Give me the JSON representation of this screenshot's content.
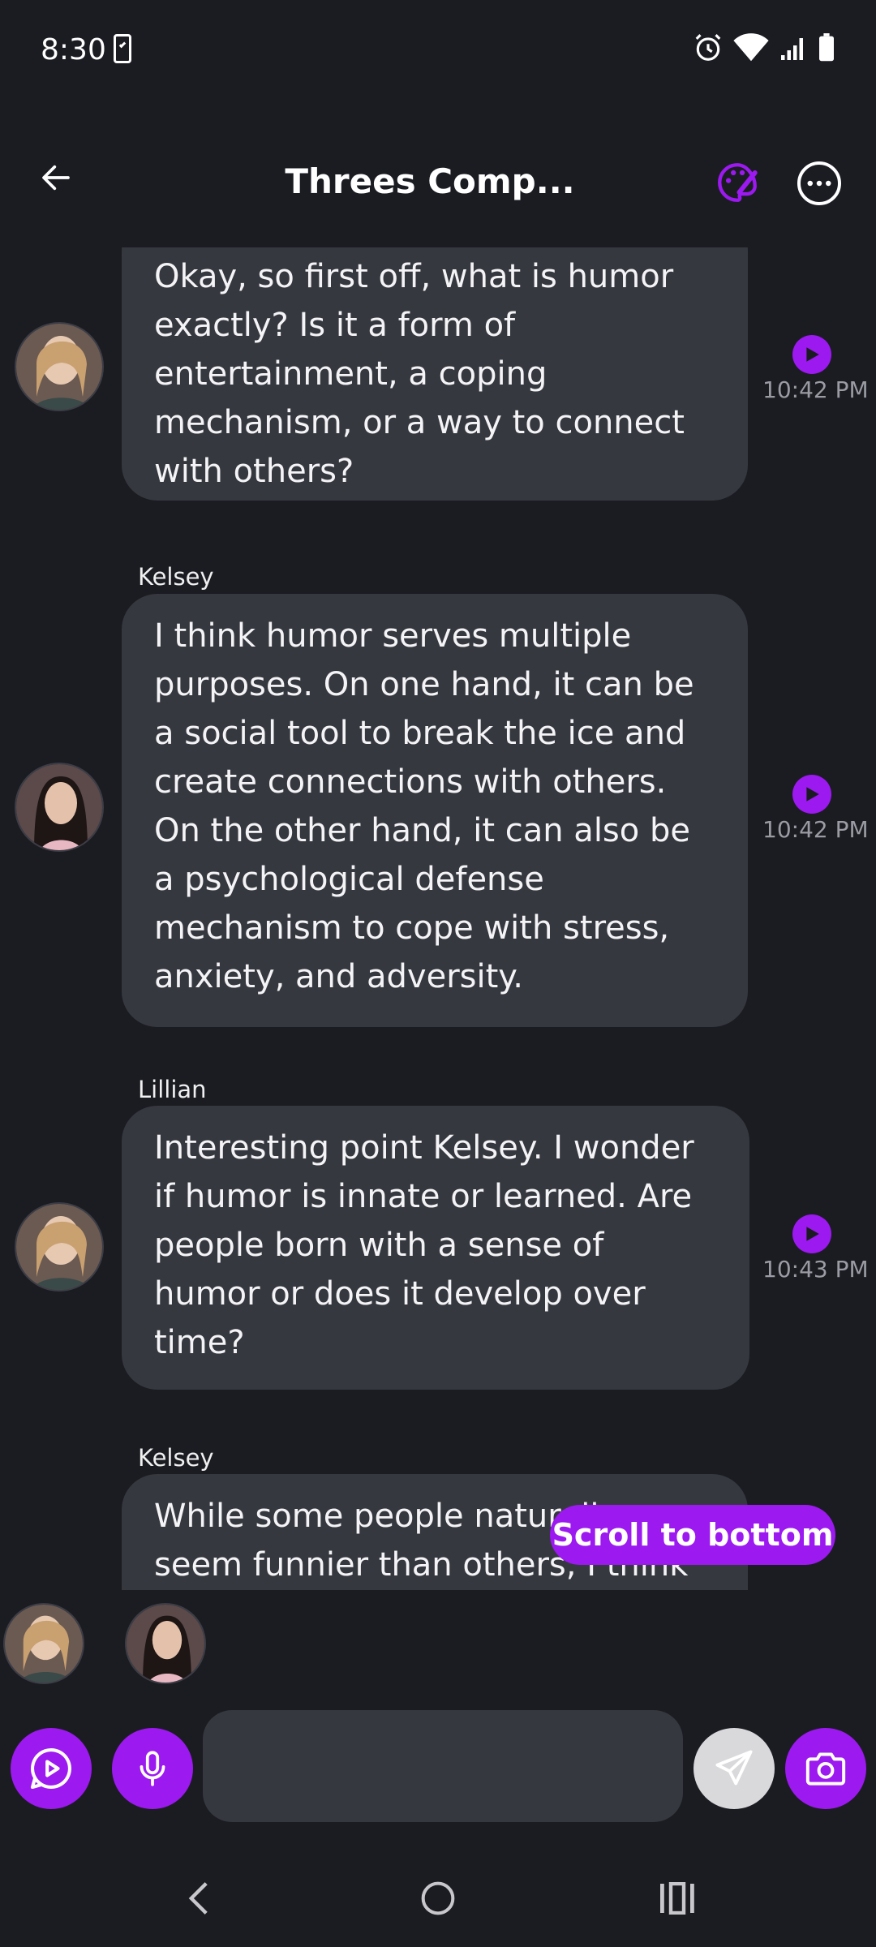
{
  "status_bar": {
    "time": "8:30"
  },
  "header": {
    "title": "Threes Comp..."
  },
  "messages": [
    {
      "sender": "",
      "text": "Okay, so first off, what is humor exactly? Is it a form of entertainment, a coping mechanism, or a way to connect with others?",
      "time": "10:42 PM",
      "avatar": "avatar-lillian"
    },
    {
      "sender": "Kelsey",
      "text": "I think humor serves multiple purposes. On one hand, it can be a social tool to break the ice and create connections with others. On the other hand, it can also be a psychological defense mechanism to cope with stress, anxiety, and adversity.",
      "time": "10:42 PM",
      "avatar": "avatar-kelsey"
    },
    {
      "sender": "Lillian",
      "text": "Interesting point Kelsey. I wonder if humor is innate or learned. Are people born with a sense of humor or does it develop over time?",
      "time": "10:43 PM",
      "avatar": "avatar-lillian"
    },
    {
      "sender": "Kelsey",
      "text": "While some people naturally seem funnier than others, I think",
      "time": "",
      "avatar": "avatar-kelsey"
    }
  ],
  "scroll_button": {
    "label": "Scroll to bottom"
  },
  "composer": {
    "placeholder": ""
  },
  "colors": {
    "accent": "#9c19f0",
    "background": "#1b1c22",
    "bubble": "#363840"
  }
}
